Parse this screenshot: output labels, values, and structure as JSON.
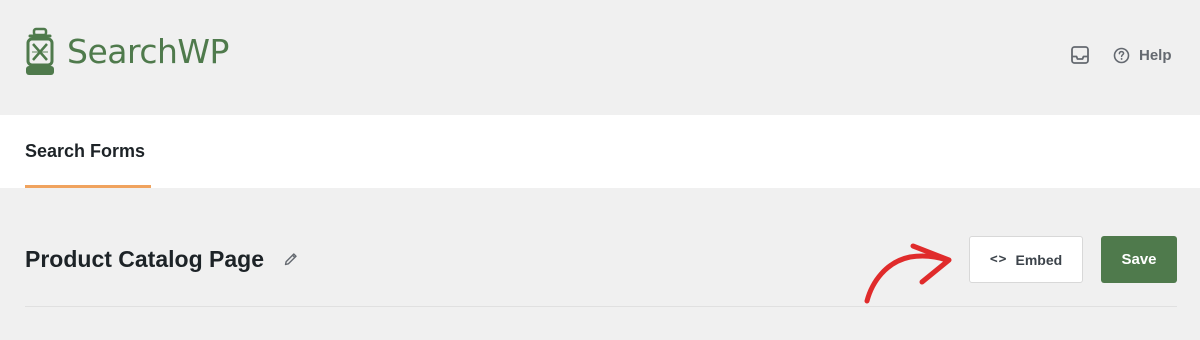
{
  "header": {
    "brand_name": "SearchWP",
    "logo_icon": "lantern-icon",
    "inbox_icon": "inbox-icon",
    "help_label": "Help",
    "help_icon": "question-circle-icon"
  },
  "tabs": [
    {
      "label": "Search Forms",
      "active": true
    }
  ],
  "page": {
    "title": "Product Catalog Page",
    "edit_icon": "pencil-icon",
    "embed_label": "Embed",
    "embed_icon": "code-icon",
    "save_label": "Save"
  },
  "annotation": {
    "type": "arrow",
    "color": "#e02b2b",
    "points_to": "embed-button"
  },
  "colors": {
    "brand_green": "#4f7a4c",
    "tab_accent": "#f0a35e",
    "page_bg": "#f0f0f0"
  }
}
